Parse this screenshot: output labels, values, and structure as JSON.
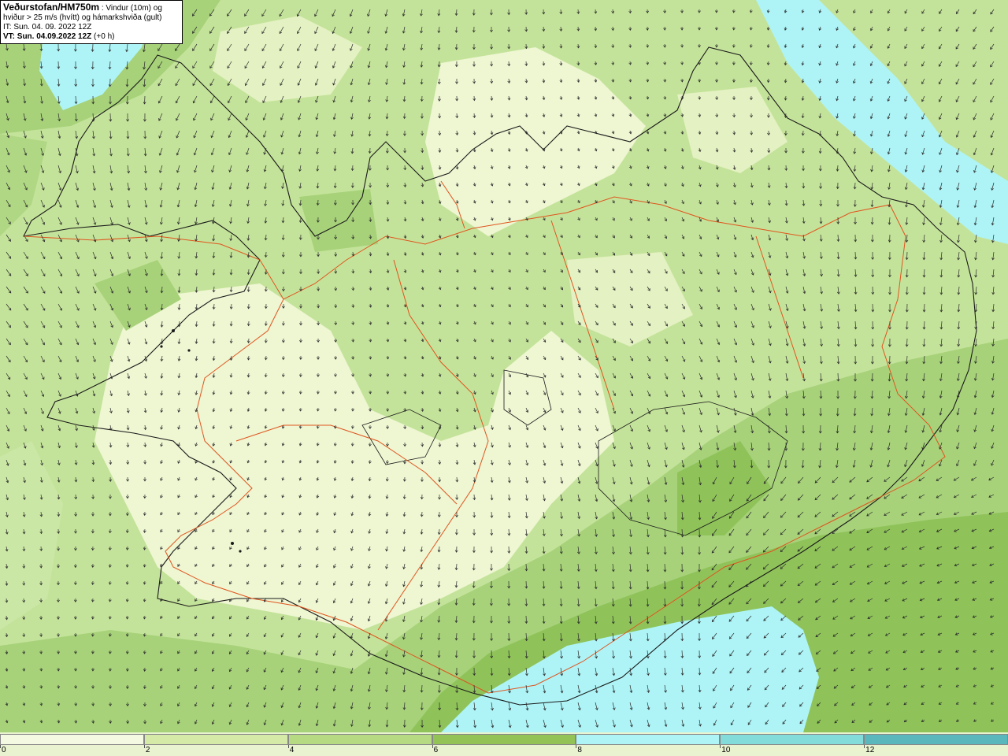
{
  "header": {
    "title": "Veðurstofan/HM750m",
    "title_suffix": " : Vindur (10m) og",
    "line2": "hviður > 25 m/s (hvítt) og hámarkshviða (gult)",
    "line3": "IT: Sun. 04. 09. 2022 12Z",
    "line4": "VT: Sun. 04.09.2022 12Z",
    "line4_suffix": " (+0 h)"
  },
  "legend": {
    "bins": [
      {
        "from": 0,
        "to": 2,
        "color": "#f4f9e1"
      },
      {
        "from": 2,
        "to": 4,
        "color": "#d5eaa6"
      },
      {
        "from": 4,
        "to": 6,
        "color": "#b6da82"
      },
      {
        "from": 6,
        "to": 8,
        "color": "#93c257"
      },
      {
        "from": 8,
        "to": 10,
        "color": "#aef4f7"
      },
      {
        "from": 10,
        "to": 12,
        "color": "#83dcda"
      },
      {
        "from": 12,
        "to": 14,
        "color": "#5ab8bc"
      }
    ],
    "tick_labels": [
      "0",
      "2",
      "4",
      "6",
      "8",
      "10",
      "12"
    ]
  },
  "colors": {
    "road": "#e0541e",
    "coast": "#1a1a1a",
    "arrow": "#2a2a2a"
  }
}
